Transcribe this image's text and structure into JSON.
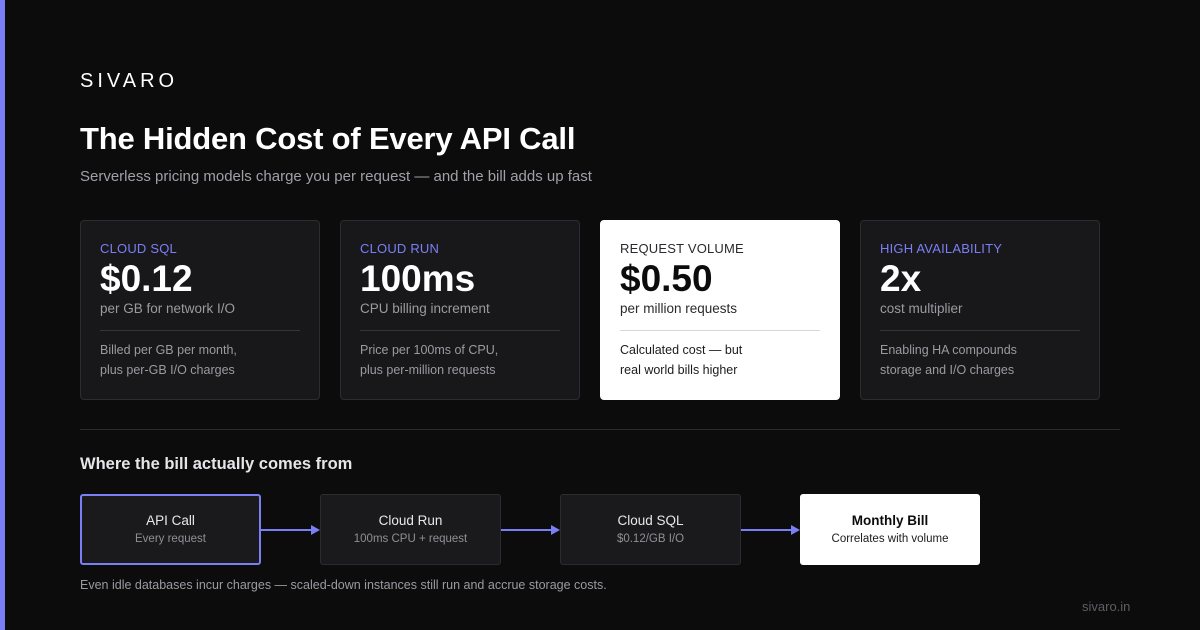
{
  "brand": "SIVARO",
  "title": "The Hidden Cost of Every API Call",
  "subtitle": "Serverless pricing models charge you per request — and the bill adds up fast",
  "colors": {
    "accent": "#7b7ff5",
    "background": "#0c0c0c",
    "highlight": "#ffffff"
  },
  "cards": [
    {
      "label": "CLOUD SQL",
      "value": "$0.12",
      "unit": "per GB for network I/O",
      "note_line1": "Billed per GB per month,",
      "note_line2": "plus per-GB I/O charges"
    },
    {
      "label": "CLOUD RUN",
      "value": "100ms",
      "unit": "CPU billing increment",
      "note_line1": "Price per 100ms of CPU,",
      "note_line2": "plus per-million requests"
    },
    {
      "label": "REQUEST VOLUME",
      "value": "$0.50",
      "unit": "per million requests",
      "note_line1": "Calculated cost — but",
      "note_line2": "real world bills higher"
    },
    {
      "label": "HIGH AVAILABILITY",
      "value": "2x",
      "unit": "cost multiplier",
      "note_line1": "Enabling HA compounds",
      "note_line2": "storage and I/O charges"
    }
  ],
  "flow": {
    "title": "Where the bill actually comes from",
    "nodes": [
      {
        "title": "API Call",
        "sub": "Every request"
      },
      {
        "title": "Cloud Run",
        "sub": "100ms CPU + request"
      },
      {
        "title": "Cloud SQL",
        "sub": "$0.12/GB I/O"
      },
      {
        "title": "Monthly Bill",
        "sub": "Correlates with volume"
      }
    ]
  },
  "footnote": "Even idle databases incur charges — scaled-down instances still run and accrue storage costs.",
  "site": "sivaro.in"
}
